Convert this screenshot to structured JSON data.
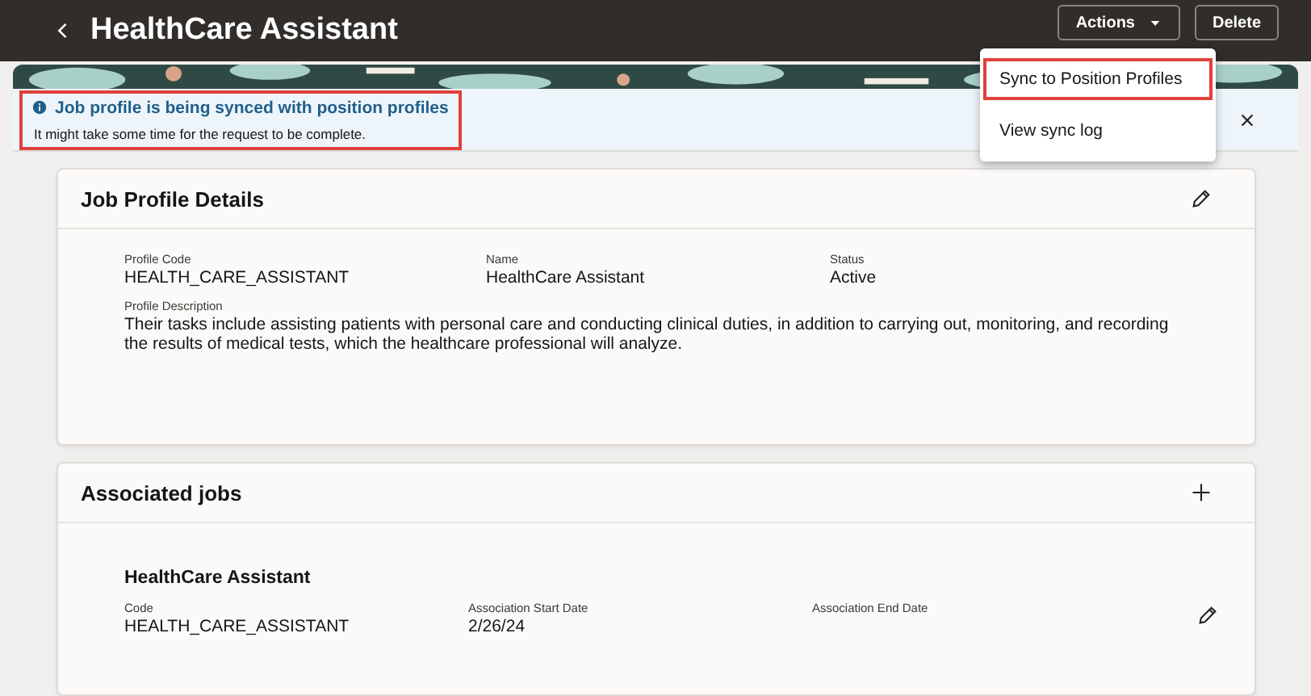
{
  "header": {
    "title": "HealthCare Assistant",
    "buttons": [
      {
        "label": "Actions",
        "kind": "menu"
      },
      {
        "label": "Delete",
        "kind": "plain"
      }
    ]
  },
  "actions_menu": {
    "items": [
      {
        "label": "Sync to Position Profiles",
        "highlighted": true
      },
      {
        "label": "View sync log",
        "highlighted": false
      }
    ]
  },
  "notice": {
    "title": "Job profile is being synced with position profiles",
    "message": "It might take some time for the request to be complete.",
    "highlighted": true
  },
  "details": {
    "title": "Job Profile Details",
    "fields": [
      {
        "label": "Profile Code",
        "value": "HEALTH_CARE_ASSISTANT"
      },
      {
        "label": "Name",
        "value": "HealthCare Assistant"
      },
      {
        "label": "Status",
        "value": "Active"
      }
    ],
    "description": {
      "label": "Profile Description",
      "value": "Their tasks include assisting patients with personal care and conducting clinical duties, in addition to carrying out, monitoring, and recording the results of medical tests, which the healthcare professional will analyze."
    }
  },
  "associated_jobs": {
    "title": "Associated jobs",
    "jobs": [
      {
        "name": "HealthCare Assistant",
        "fields": [
          {
            "label": "Code",
            "value": "HEALTH_CARE_ASSISTANT"
          },
          {
            "label": "Association Start Date",
            "value": "2/26/24"
          },
          {
            "label": "Association End Date"
          }
        ]
      }
    ]
  }
}
